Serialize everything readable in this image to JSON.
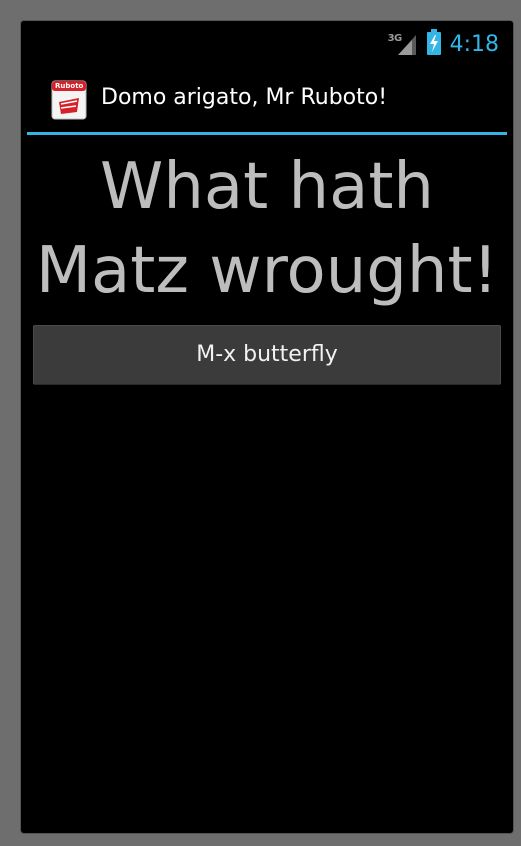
{
  "status_bar": {
    "network_type": "3G",
    "time": "4:18",
    "icons": [
      "signal-icon",
      "battery-charging-icon"
    ]
  },
  "action_bar": {
    "app_icon": "ruboto-app-icon",
    "app_icon_text": "Ruboto",
    "title": "Domo arigato, Mr Ruboto!"
  },
  "content": {
    "heading_line_1": "What hath",
    "heading_line_2": "Matz wrought!",
    "button_label": "M-x butterfly"
  },
  "colors": {
    "accent": "#33b5e5",
    "background": "#000000",
    "heading_text": "#bdbdbd",
    "button_bg": "#3b3b3b",
    "frame": "#6e6e6e"
  }
}
